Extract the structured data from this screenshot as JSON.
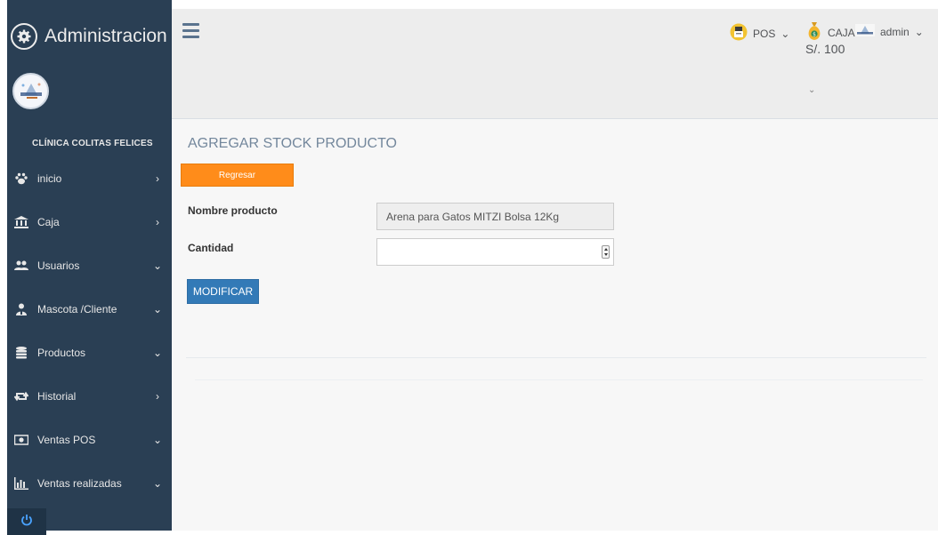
{
  "sidebar": {
    "brand_title": "Administracion",
    "clinic_name": "CLÍNICA COLITAS FELICES",
    "menu": [
      {
        "label": "inicio",
        "icon": "paw-icon",
        "arrow": "›"
      },
      {
        "label": "Caja",
        "icon": "bank-icon",
        "arrow": "›"
      },
      {
        "label": "Usuarios",
        "icon": "users-icon",
        "arrow": "⌄"
      },
      {
        "label": "Mascota /Cliente",
        "icon": "user-tie-icon",
        "arrow": "⌄"
      },
      {
        "label": "Productos",
        "icon": "database-icon",
        "arrow": "⌄"
      },
      {
        "label": "Historial",
        "icon": "retweet-icon",
        "arrow": "›"
      },
      {
        "label": "Ventas POS",
        "icon": "money-icon",
        "arrow": "⌄"
      },
      {
        "label": "Ventas realizadas",
        "icon": "bar-chart-icon",
        "arrow": "⌄"
      }
    ]
  },
  "topbar": {
    "pos_label": "POS",
    "caja_label": "CAJA",
    "caja_amount": "S/. 100",
    "user_label": "admin",
    "caret": "⌄"
  },
  "main": {
    "title": "AGREGAR STOCK PRODUCTO",
    "back_button": "Regresar",
    "product_name_label": "Nombre producto",
    "product_name_value": "Arena para Gatos MITZI Bolsa 12Kg",
    "quantity_label": "Cantidad",
    "quantity_value": "",
    "submit_button": "MODIFICAR"
  },
  "colors": {
    "sidebar_bg": "#2a3f54",
    "topbar_bg": "#ededed",
    "main_bg": "#f7f7f7",
    "back_button_bg": "#ff8c1a",
    "submit_button_bg": "#337ab7"
  }
}
